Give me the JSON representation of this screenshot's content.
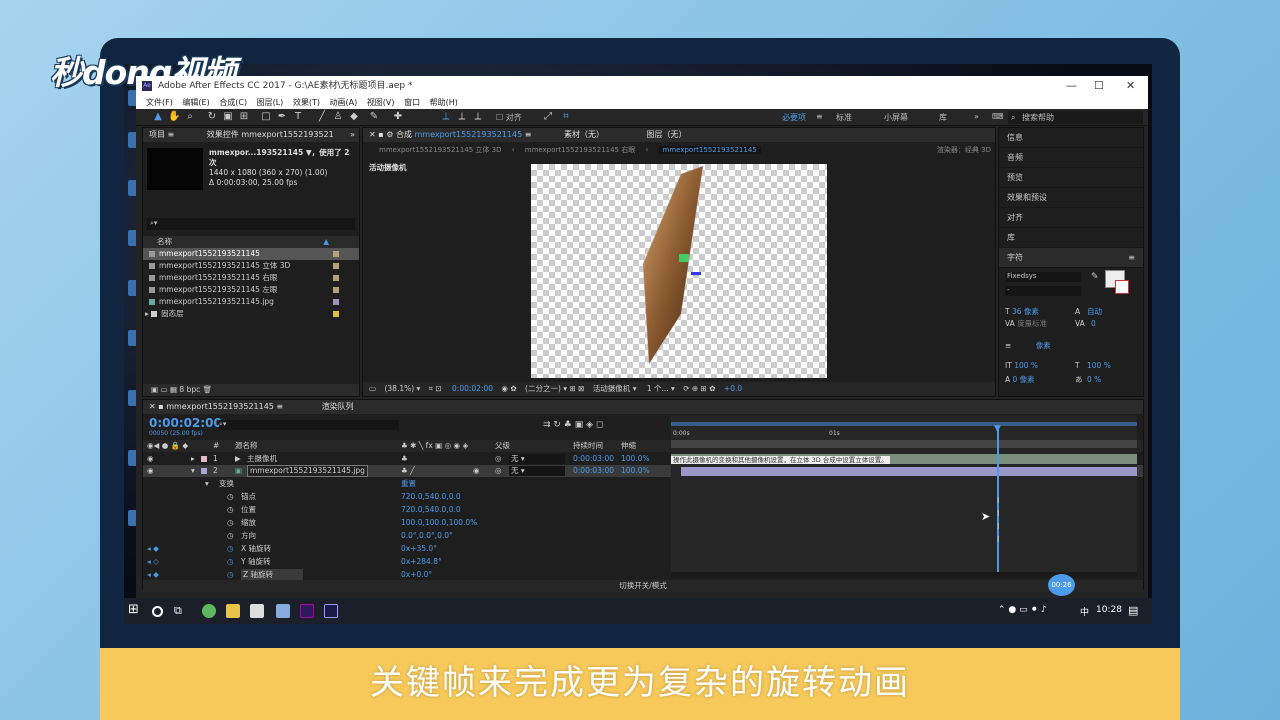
{
  "logo": "秒dong视频",
  "subtitle": "关键帧来完成更为复杂的旋转动画",
  "window": {
    "title": "Adobe After Effects CC 2017 - G:\\AE素材\\无标题项目.aep *",
    "min": "—",
    "max": "☐",
    "close": "✕"
  },
  "menu": [
    "文件(F)",
    "编辑(E)",
    "合成(C)",
    "图层(L)",
    "效果(T)",
    "动画(A)",
    "视图(V)",
    "窗口",
    "帮助(H)"
  ],
  "toolbar": {
    "align": "对齐",
    "ws_essential": "必要项",
    "ws_standard": "标准",
    "ws_small": "小屏幕",
    "ws_lib": "库",
    "search": "搜索帮助"
  },
  "project": {
    "tab": "项目",
    "tab2": "效果控件 mmexport1552193521",
    "name": "mmexpor...193521145 ▼，使用了 2 次",
    "dims": "1440 x 1080  (360 x 270) (1.00)",
    "dur": "Δ 0:00:03:00, 25.00 fps",
    "col_name": "名称",
    "bpc": "8 bpc",
    "items": [
      {
        "n": "mmexport1552193521145",
        "c": "#b8a070"
      },
      {
        "n": "mmexport1552193521145 立体 3D",
        "c": "#b8a070"
      },
      {
        "n": "mmexport1552193521145 右眼",
        "c": "#b8a070"
      },
      {
        "n": "mmexport1552193521145 左眼",
        "c": "#b8a070"
      },
      {
        "n": "mmexport1552193521145.jpg",
        "c": "#a090c0"
      },
      {
        "n": "固态层",
        "c": "#e0c040"
      }
    ]
  },
  "comp": {
    "tab": "合成",
    "comp_name": "mmexport1552193521145",
    "footage": "素材（无）",
    "layer": "图层（无）",
    "crumb1": "mmexport1552193521145 立体 3D",
    "crumb2": "mmexport1552193521145 右眼",
    "crumb3": "mmexport1552193521145",
    "renderer": "渲染器：经典 3D",
    "camera": "活动摄像机",
    "zoom": "(38.1%)",
    "time": "0:00:02:00",
    "res": "(二分之一)",
    "view": "活动摄像机",
    "views": "1 个...",
    "exposure": "+0.0"
  },
  "right": {
    "items": [
      "信息",
      "音频",
      "预览",
      "效果和预设",
      "对齐",
      "库"
    ],
    "char": "字符",
    "font": "Fixedsys",
    "style": "-",
    "size": "36 像素",
    "leading": "自动",
    "kern": "度量标准",
    "track": "0",
    "unit": "像素",
    "vscale": "100 %",
    "hscale": "100 %",
    "baseline": "0 像素",
    "tsume": "0 %"
  },
  "timeline": {
    "tab": "mmexport1552193521145",
    "queue": "渲染队列",
    "time": "0:00:02:00",
    "frames": "00050 (25.00 fps)",
    "col_num": "#",
    "col_name": "源名称",
    "col_parent": "父级",
    "col_dur": "持续时间",
    "col_stretch": "伸缩",
    "ruler0": "0:00s",
    "ruler1": "01s",
    "switch_mode": "切换开关/模式",
    "layers": [
      {
        "num": "1",
        "name": "主摄像机",
        "parent": "无",
        "dur": "0:00:03:00",
        "stretch": "100.0%"
      },
      {
        "num": "2",
        "name": "mmexport1552193521145.jpg",
        "parent": "无",
        "dur": "0:00:03:00",
        "stretch": "100.0%"
      }
    ],
    "props": [
      {
        "n": "变换",
        "v": "重置"
      },
      {
        "n": "锚点",
        "v": "720.0,540.0,0.0"
      },
      {
        "n": "位置",
        "v": "720.0,540.0,0.0"
      },
      {
        "n": "缩放",
        "v": "100.0,100.0,100.0%"
      },
      {
        "n": "方向",
        "v": "0.0°,0.0°,0.0°"
      },
      {
        "n": "X 轴旋转",
        "v": "0x+35.0°"
      },
      {
        "n": "Y 轴旋转",
        "v": "0x+284.8°"
      },
      {
        "n": "Z 轴旋转",
        "v": "0x+0.0°"
      }
    ],
    "tooltip": "操作此摄像机的变换和其他摄像机设置，在立体 3D 合成中设置立体设置。"
  },
  "taskbar": {
    "clock": "10:28",
    "ime": "中",
    "badge": "00:26"
  }
}
